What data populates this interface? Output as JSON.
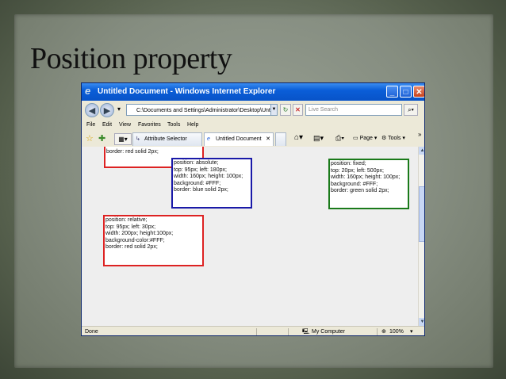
{
  "slide": {
    "title": "Position property"
  },
  "window": {
    "title": "Untitled Document - Windows Internet Explorer",
    "controls": {
      "minimize": "_",
      "maximize": "□",
      "close": "✕"
    }
  },
  "address_bar": {
    "url": "C:\\Documents and Settings\\Administrator\\Desktop\\Untitl",
    "search_placeholder": "Live Search"
  },
  "menu": [
    "File",
    "Edit",
    "View",
    "Favorites",
    "Tools",
    "Help"
  ],
  "command_bar": {
    "tabs": [
      {
        "label": "Attribute Selector"
      },
      {
        "label": "Untitled Document"
      }
    ],
    "page_label": "Page",
    "tools_label": "Tools"
  },
  "content": {
    "box_top_red": "border: red solid 2px;",
    "box_absolute": [
      "position: absolute;",
      "top: 95px; left: 180px;",
      "width: 160px; height: 100px;",
      "background: #FFF;",
      "border: blue solid 2px;"
    ],
    "box_fixed": [
      "position: fixed;",
      "top: 20px; left: 500px;",
      "width: 160px; height: 100px;",
      "background: #FFF;",
      "border: green solid 2px;"
    ],
    "box_relative": [
      "position: relative;",
      "top: 95px; left: 30px;",
      "width: 200px; height:100px;",
      "background-color:#FFF;",
      "border: red solid 2px;"
    ]
  },
  "status": {
    "left": "Done",
    "zone": "My Computer",
    "zoom": "100%"
  },
  "colors": {
    "titlebar": "#0a5ed8",
    "red_border": "#dd2222",
    "blue_border": "#1a1aa8",
    "green_border": "#1a7a1a"
  }
}
